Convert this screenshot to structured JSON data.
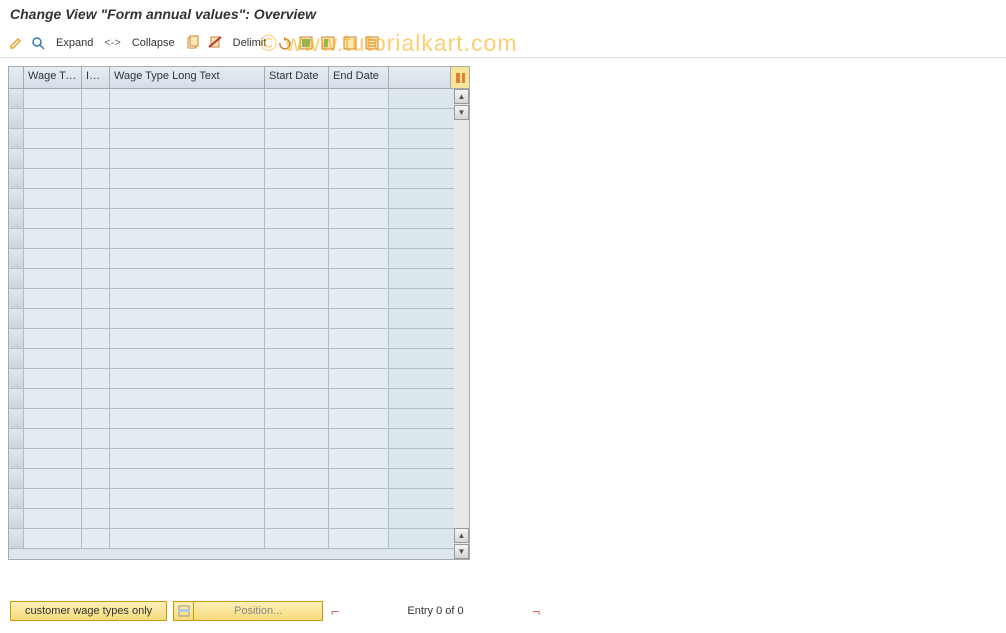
{
  "title": "Change View \"Form annual values\": Overview",
  "watermark": "© www.tutorialkart.com",
  "toolbar": {
    "expand_label": "Expand",
    "sep_label": "<->",
    "collapse_label": "Collapse",
    "delimit_label": "Delimit"
  },
  "table": {
    "headers": {
      "wage_type": "Wage Ty…",
      "inf": "Inf…",
      "long_text": "Wage Type Long Text",
      "start_date": "Start Date",
      "end_date": "End Date"
    },
    "row_count": 23
  },
  "footer": {
    "customer_btn": "customer wage types only",
    "position_btn": "Position...",
    "entry_text": "Entry 0 of 0"
  }
}
